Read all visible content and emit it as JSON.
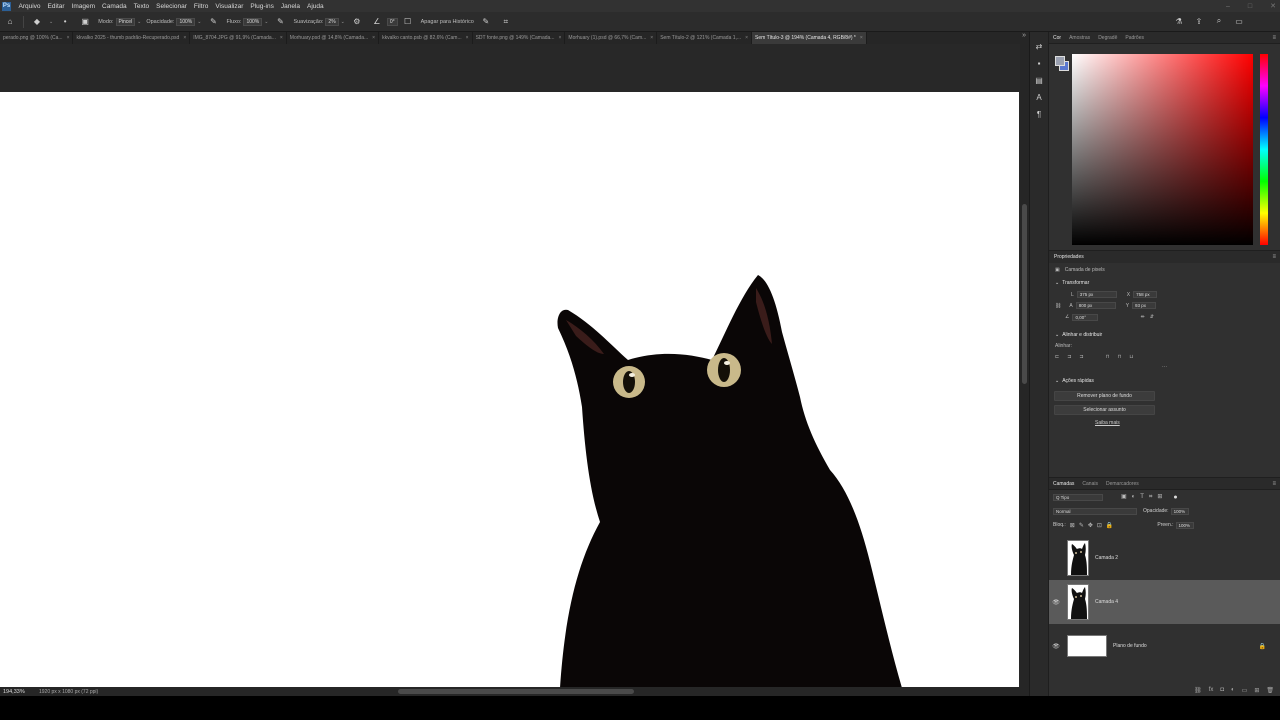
{
  "menu": [
    "Arquivo",
    "Editar",
    "Imagem",
    "Camada",
    "Texto",
    "Selecionar",
    "Filtro",
    "Visualizar",
    "Plug-ins",
    "Janela",
    "Ajuda"
  ],
  "options": {
    "modo_label": "Modo:",
    "modo_value": "Pincel",
    "opacidade_label": "Opacidade:",
    "opacidade_value": "100%",
    "fluxo_label": "Fluxo:",
    "fluxo_value": "100%",
    "suavizacao_label": "Suavização:",
    "suavizacao_value": "2%",
    "angle_value": "0°",
    "apagar_label": "Apagar para Histórico"
  },
  "tabs": [
    {
      "label": "perado.png @ 100% (Ca..."
    },
    {
      "label": "kkvalko 2025 - thumb padrão-Recuperado.psd"
    },
    {
      "label": "IMG_8704.JPG @ 91,9% (Camada..."
    },
    {
      "label": "Morhuary.psd @ 14,8% (Camada..."
    },
    {
      "label": "kkvalko canto.psb @ 82,6% (Cam..."
    },
    {
      "label": "SDT fonte.png @ 149% (Camada..."
    },
    {
      "label": "Morhuary (1).psd @ 66,7% (Cam..."
    },
    {
      "label": "Sem Título-2 @ 121% (Camada 1,..."
    },
    {
      "label": "Sem Título-3 @ 194% (Camada 4, RGB/8#) *"
    }
  ],
  "status": {
    "zoom": "194,33%",
    "dims": "1920 px x 1080 px (72 ppi)"
  },
  "color_panel": {
    "tabs": [
      "Cor",
      "Amostras",
      "Degradê",
      "Padrões"
    ]
  },
  "properties": {
    "title": "Propriedades",
    "layer_type": "Camada de pixels",
    "transform_title": "Transformar",
    "w_label": "L",
    "w_value": "375 px",
    "h_label": "A",
    "h_value": "800 px",
    "x_label": "X",
    "x_value": "758 px",
    "y_label": "Y",
    "y_value": "93 px",
    "angle_value": "0,00°",
    "align_title": "Alinhar e distribuir",
    "align_label": "Alinhar:",
    "quick_title": "Ações rápidas",
    "btn_remove_bg": "Remover plano de fundo",
    "btn_select_subject": "Selecionar assunto",
    "more_link": "Saiba mais"
  },
  "layers_panel": {
    "tabs": [
      "Camadas",
      "Canais",
      "Demarcadores"
    ],
    "search_value": "Q Tipo",
    "blend_value": "Normal",
    "opacidade_label": "Opacidade:",
    "opacidade_value": "100%",
    "bloq_label": "Bloq.:",
    "preench_label": "Preen.:",
    "preench_value": "100%",
    "layers": [
      {
        "name": "Camada 2",
        "visible": false,
        "selected": false
      },
      {
        "name": "Camada 4",
        "visible": true,
        "selected": true
      },
      {
        "name": "Plano de fundo",
        "visible": true,
        "selected": false,
        "locked": true
      }
    ]
  }
}
